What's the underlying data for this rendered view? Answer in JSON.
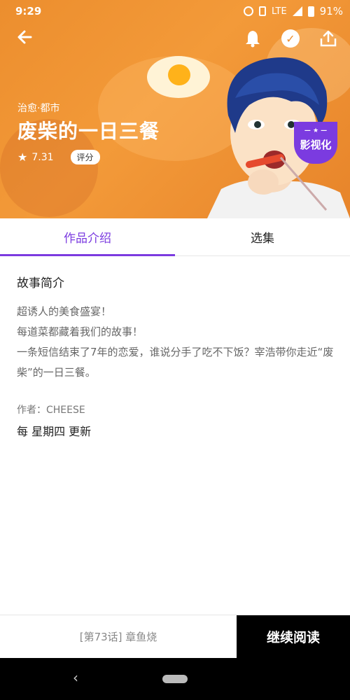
{
  "status_bar": {
    "time": "9:29",
    "network": "LTE",
    "battery": "91%"
  },
  "hero": {
    "genre": "治愈·都市",
    "title": "废柴的一日三餐",
    "rating": "7.31",
    "rate_button": "评分",
    "badge": "影视化"
  },
  "tabs": [
    {
      "label": "作品介绍",
      "active": true
    },
    {
      "label": "选集",
      "active": false
    }
  ],
  "intro": {
    "section_title": "故事简介",
    "lines": [
      "超诱人的美食盛宴！",
      "每道菜都藏着我们的故事！",
      "一条短信结束了7年的恋爱，谁说分手了吃不下饭？宰浩带你走近“废柴”的一日三餐。"
    ],
    "author": "作者：CHEESE",
    "schedule": "每 星期四 更新"
  },
  "bottom": {
    "last_read": "[第73话] 章鱼烧",
    "continue": "继续阅读"
  },
  "colors": {
    "accent": "#7b3be0",
    "hero": "#ec8e2e"
  }
}
